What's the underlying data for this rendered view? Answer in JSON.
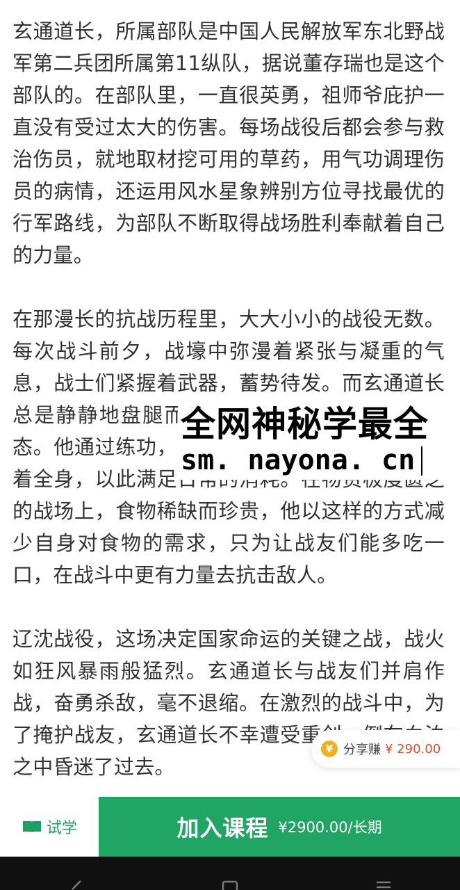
{
  "article": {
    "paragraphs": [
      "玄通道长，所属部队是中国人民解放军东北野战军第二兵团所属第11纵队，据说董存瑞也是这个部队的。在部队里，一直很英勇，祖师爷庇护一直没有受过太大的伤害。每场战役后都会参与救治伤员，就地取材挖可用的草药，用气功调理伤员的病情，还运用风水星象辨别方位寻找最优的行军路线，为部队不断取得战场胜利奉献着自己的力量。",
      "在那漫长的抗战历程里，大大小小的战役无数。每次战斗前夕，战壕中弥漫着紧张与凝重的气息，战士们紧握着武器，蓄势待发。而玄通道长总是静静地盘腿而坐，进入一种物我两忘的状态。他通过练功，让体内的气在周身运转，滋养着全身，以此满足日常的消耗。在物资极度匮乏的战场上，食物稀缺而珍贵，他以这样的方式减少自身对食物的需求，只为让战友们能多吃一口，在战斗中更有力量去抗击敌人。",
      "辽沈战役，这场决定国家命运的关键之战，战火如狂风暴雨般猛烈。玄通道长与战友们并肩作战，奋勇杀敌，毫不退缩。在激烈的战斗中，为了掩护战友，玄通道长不幸遭受重创，倒在血泊之中昏迷了过去。"
    ]
  },
  "watermark": {
    "line1": "全网神秘学最全",
    "line2": "sm. nayona. cn"
  },
  "share": {
    "coin_icon": "¥",
    "label": "分享赚",
    "price": "¥ 290.00"
  },
  "bottom_bar": {
    "trial_label": "试学",
    "join_label": "加入课程",
    "join_price": "¥2900.00/长期"
  },
  "colors": {
    "accent_green": "#21a565",
    "trial_green": "#1aa064",
    "share_price_red": "#e04b2c",
    "coin_orange": "#f2b01e"
  },
  "nav": {
    "icons": [
      "back-icon",
      "home-icon",
      "menu-icon"
    ]
  }
}
